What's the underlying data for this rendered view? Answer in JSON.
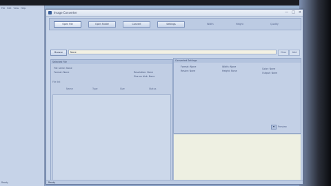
{
  "background_window": {
    "menu": [
      "File",
      "Edit",
      "View",
      "Help"
    ],
    "status": "Ready"
  },
  "window": {
    "title": "Image Converter",
    "controls": [
      "—",
      "□",
      "×"
    ]
  },
  "toolbar": {
    "buttons": [
      "Open File",
      "Open Folder",
      "Convert",
      "Settings"
    ],
    "texts": [
      "Width",
      "Height",
      "Quality"
    ]
  },
  "path": {
    "button_label": "Browse",
    "value": "None",
    "side": [
      "Clear",
      "Add"
    ]
  },
  "left_panel": {
    "header": "Selected File",
    "info": [
      "File name: None",
      "Format: None",
      "Resolution: None",
      "Size on disk: None"
    ],
    "subheader": "File list",
    "columns": [
      "Name",
      "Type",
      "Size",
      "Status"
    ]
  },
  "right_panel": {
    "header": "Converted Settings",
    "info": [
      "Format: None",
      "Resize: None",
      "Width: None",
      "Height: None",
      "Color: None",
      "Output: None"
    ],
    "scroll_label": "Preview"
  },
  "status_bar": {
    "text": "Ready"
  },
  "colors": {
    "accent": "#3a5f9a",
    "window_bg": "#c9d6ea",
    "input_bg": "#f3f1e3"
  }
}
